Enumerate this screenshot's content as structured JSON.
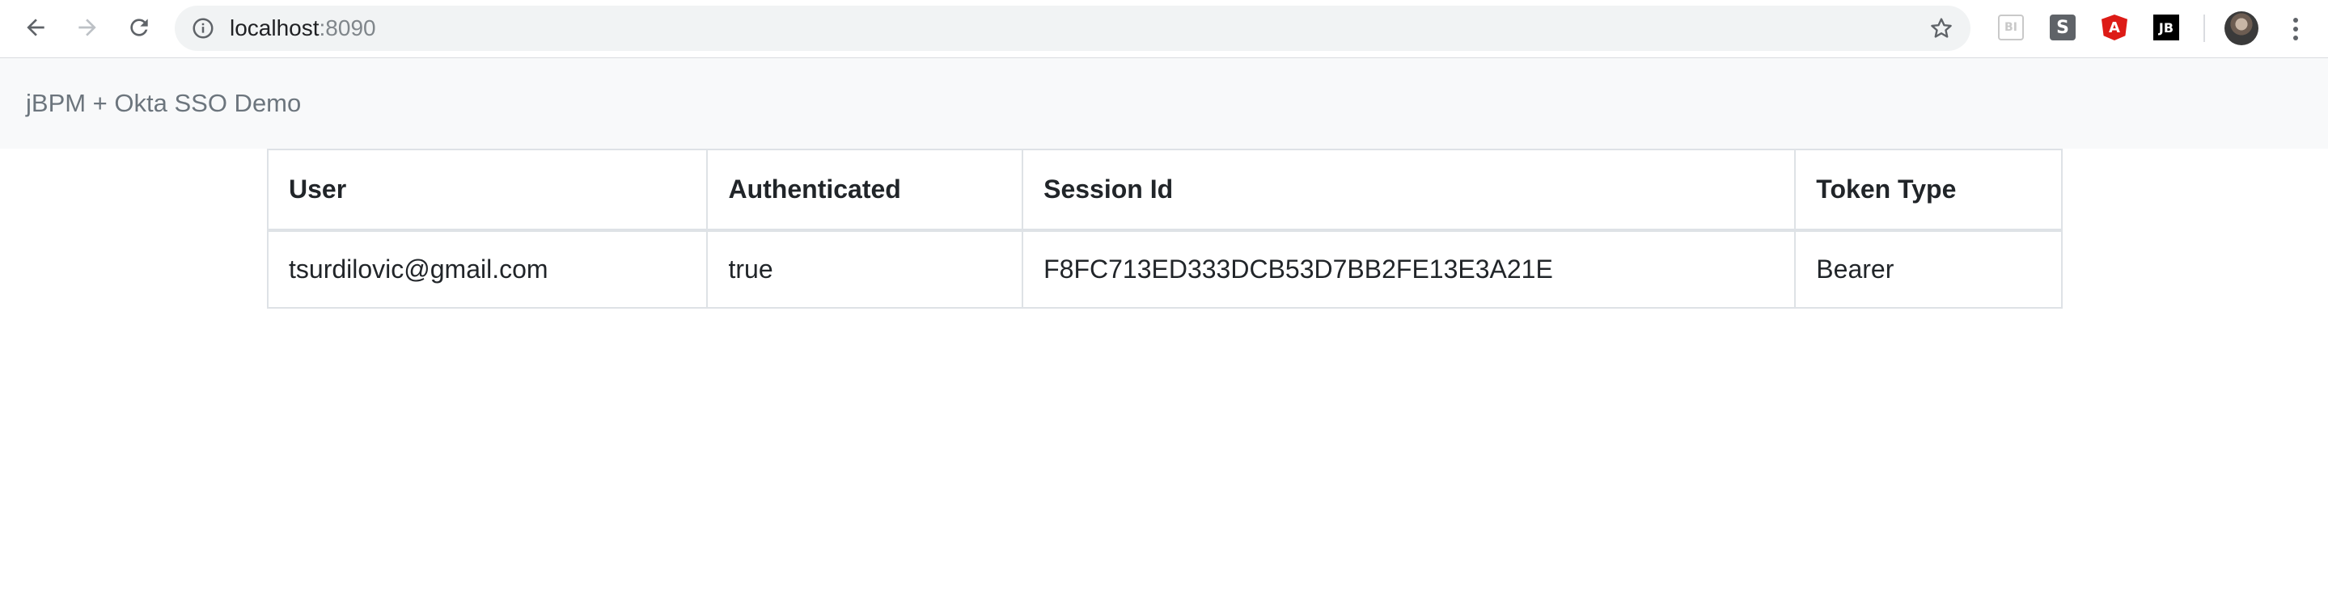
{
  "browser": {
    "url_host": "localhost",
    "url_port": ":8090",
    "extensions": [
      {
        "name": "bi-extension-icon",
        "label": "BI",
        "color": "#c9c9c9"
      },
      {
        "name": "s-extension-icon",
        "label": "S",
        "color": "#5f6368"
      },
      {
        "name": "angular-extension-icon",
        "label": "A",
        "color": "#dd1b16"
      },
      {
        "name": "jb-extension-icon",
        "label": "JB",
        "color": "#000000"
      }
    ]
  },
  "navbar": {
    "brand": "jBPM + Okta SSO Demo"
  },
  "table": {
    "headers": [
      "User",
      "Authenticated",
      "Session Id",
      "Token Type"
    ],
    "rows": [
      [
        "tsurdilovic@gmail.com",
        "true",
        "F8FC713ED333DCB53D7BB2FE13E3A21E",
        "Bearer"
      ]
    ]
  }
}
